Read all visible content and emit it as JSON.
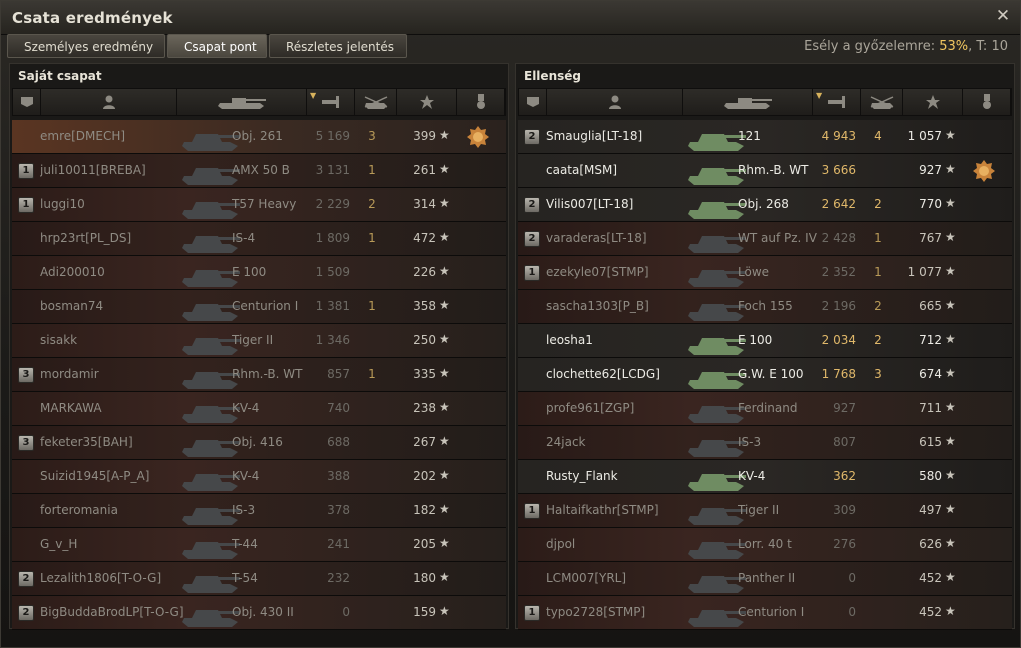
{
  "window": {
    "title": "Csata eredmények"
  },
  "tabs": [
    {
      "label": "Személyes eredmény"
    },
    {
      "label": "Csapat pont"
    },
    {
      "label": "Részletes jelentés"
    }
  ],
  "chance": {
    "prefix": "Esély a győzelemre:",
    "percent": "53%",
    "suffix": "T: 10"
  },
  "colors": {
    "accent": "#f0c660",
    "alive_damage": "#e0b86a"
  },
  "left": {
    "title": "Saját csapat",
    "rows": [
      {
        "platoon": "",
        "name": "emre[DMECH]",
        "tank": "Obj. 261",
        "damage": "5 169",
        "kills": "3",
        "score": "399",
        "medal": true,
        "self": true,
        "alive": false
      },
      {
        "platoon": "1",
        "name": "juli10011[BREBA]",
        "tank": "AMX 50 B",
        "damage": "3 131",
        "kills": "1",
        "score": "261",
        "medal": false,
        "self": false,
        "alive": false
      },
      {
        "platoon": "1",
        "name": "luggi10",
        "tank": "T57 Heavy",
        "damage": "2 229",
        "kills": "2",
        "score": "314",
        "medal": false,
        "self": false,
        "alive": false
      },
      {
        "platoon": "",
        "name": "hrp23rt[PL_DS]",
        "tank": "IS-4",
        "damage": "1 809",
        "kills": "1",
        "score": "472",
        "medal": false,
        "self": false,
        "alive": false
      },
      {
        "platoon": "",
        "name": "Adi200010",
        "tank": "E 100",
        "damage": "1 509",
        "kills": "",
        "score": "226",
        "medal": false,
        "self": false,
        "alive": false
      },
      {
        "platoon": "",
        "name": "bosman74",
        "tank": "Centurion I",
        "damage": "1 381",
        "kills": "1",
        "score": "358",
        "medal": false,
        "self": false,
        "alive": false
      },
      {
        "platoon": "",
        "name": "sisakk",
        "tank": "Tiger II",
        "damage": "1 346",
        "kills": "",
        "score": "250",
        "medal": false,
        "self": false,
        "alive": false
      },
      {
        "platoon": "3",
        "name": "mordamir",
        "tank": "Rhm.-B. WT",
        "damage": "857",
        "kills": "1",
        "score": "335",
        "medal": false,
        "self": false,
        "alive": false
      },
      {
        "platoon": "",
        "name": "MARKAWA",
        "tank": "KV-4",
        "damage": "740",
        "kills": "",
        "score": "238",
        "medal": false,
        "self": false,
        "alive": false
      },
      {
        "platoon": "3",
        "name": "feketer35[BAH]",
        "tank": "Obj. 416",
        "damage": "688",
        "kills": "",
        "score": "267",
        "medal": false,
        "self": false,
        "alive": false
      },
      {
        "platoon": "",
        "name": "Suizid1945[A-P_A]",
        "tank": "KV-4",
        "damage": "388",
        "kills": "",
        "score": "202",
        "medal": false,
        "self": false,
        "alive": false
      },
      {
        "platoon": "",
        "name": "forteromania",
        "tank": "IS-3",
        "damage": "378",
        "kills": "",
        "score": "182",
        "medal": false,
        "self": false,
        "alive": false
      },
      {
        "platoon": "",
        "name": "G_v_H",
        "tank": "T-44",
        "damage": "241",
        "kills": "",
        "score": "205",
        "medal": false,
        "self": false,
        "alive": false
      },
      {
        "platoon": "2",
        "name": "Lezalith1806[T-O-G]",
        "tank": "T-54",
        "damage": "232",
        "kills": "",
        "score": "180",
        "medal": false,
        "self": false,
        "alive": false
      },
      {
        "platoon": "2",
        "name": "BigBuddaBrodLP[T-O-G]",
        "tank": "Obj. 430 II",
        "damage": "0",
        "kills": "",
        "score": "159",
        "medal": false,
        "self": false,
        "alive": false
      }
    ]
  },
  "right": {
    "title": "Ellenség",
    "rows": [
      {
        "platoon": "2",
        "name": "Smauglia[LT-18]",
        "tank": "121",
        "damage": "4 943",
        "kills": "4",
        "score": "1 057",
        "medal": false,
        "alive": true
      },
      {
        "platoon": "",
        "name": "caata[MSM]",
        "tank": "Rhm.-B. WT",
        "damage": "3 666",
        "kills": "",
        "score": "927",
        "medal": true,
        "alive": true
      },
      {
        "platoon": "2",
        "name": "Vilis007[LT-18]",
        "tank": "Obj. 268",
        "damage": "2 642",
        "kills": "2",
        "score": "770",
        "medal": false,
        "alive": true
      },
      {
        "platoon": "2",
        "name": "varaderas[LT-18]",
        "tank": "WT auf Pz. IV",
        "damage": "2 428",
        "kills": "1",
        "score": "767",
        "medal": false,
        "alive": false
      },
      {
        "platoon": "1",
        "name": "ezekyle07[STMP]",
        "tank": "Löwe",
        "damage": "2 352",
        "kills": "1",
        "score": "1 077",
        "medal": false,
        "alive": false
      },
      {
        "platoon": "",
        "name": "sascha1303[P_B]",
        "tank": "Foch 155",
        "damage": "2 196",
        "kills": "2",
        "score": "665",
        "medal": false,
        "alive": false
      },
      {
        "platoon": "",
        "name": "leosha1",
        "tank": "E 100",
        "damage": "2 034",
        "kills": "2",
        "score": "712",
        "medal": false,
        "alive": true
      },
      {
        "platoon": "",
        "name": "clochette62[LCDG]",
        "tank": "G.W. E 100",
        "damage": "1 768",
        "kills": "3",
        "score": "674",
        "medal": false,
        "alive": true
      },
      {
        "platoon": "",
        "name": "profe961[ZGP]",
        "tank": "Ferdinand",
        "damage": "927",
        "kills": "",
        "score": "711",
        "medal": false,
        "alive": false
      },
      {
        "platoon": "",
        "name": "24jack",
        "tank": "IS-3",
        "damage": "807",
        "kills": "",
        "score": "615",
        "medal": false,
        "alive": false
      },
      {
        "platoon": "",
        "name": "Rusty_Flank",
        "tank": "KV-4",
        "damage": "362",
        "kills": "",
        "score": "580",
        "medal": false,
        "alive": true
      },
      {
        "platoon": "1",
        "name": "Haltaifkathr[STMP]",
        "tank": "Tiger II",
        "damage": "309",
        "kills": "",
        "score": "497",
        "medal": false,
        "alive": false
      },
      {
        "platoon": "",
        "name": "djpol",
        "tank": "Lorr. 40 t",
        "damage": "276",
        "kills": "",
        "score": "626",
        "medal": false,
        "alive": false
      },
      {
        "platoon": "",
        "name": "LCM007[YRL]",
        "tank": "Panther II",
        "damage": "0",
        "kills": "",
        "score": "452",
        "medal": false,
        "alive": false
      },
      {
        "platoon": "1",
        "name": "typo2728[STMP]",
        "tank": "Centurion I",
        "damage": "0",
        "kills": "",
        "score": "452",
        "medal": false,
        "alive": false
      }
    ]
  }
}
